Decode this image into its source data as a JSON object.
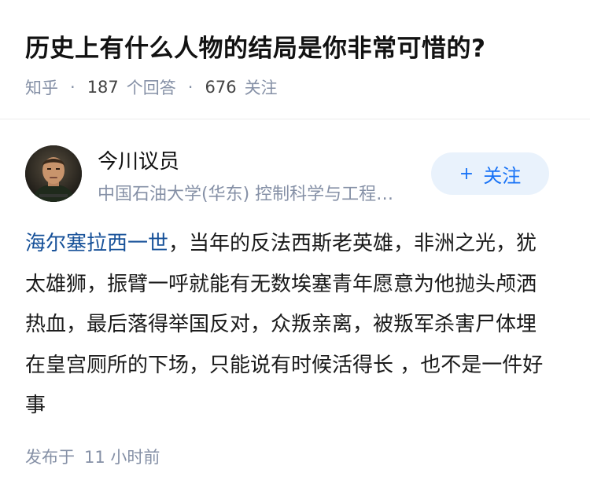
{
  "question": {
    "title": "历史上有什么人物的结局是你非常可惜的?",
    "source": "知乎",
    "separator": "·",
    "answer_count": "187",
    "answer_label": "个回答",
    "follower_count": "676",
    "follower_label": "关注"
  },
  "author": {
    "name": "今川议员",
    "bio": "中国石油大学(华东) 控制科学与工程…",
    "follow_plus": "+",
    "follow_label": "关注"
  },
  "answer": {
    "link_text": "海尔塞拉西一世",
    "body": "，当年的反法西斯老英雄，非洲之光，犹太雄狮，振臂一呼就能有无数埃塞青年愿意为他抛头颅洒热血，最后落得举国反对，众叛亲离，被叛军杀害尸体埋在皇宫厕所的下场，只能说有时候活得长 ，也不是一件好事"
  },
  "footer": {
    "published_label": "发布于",
    "published_time": "11 小时前"
  },
  "colors": {
    "meta_gray": "#8590a6",
    "link_blue": "#175199",
    "follow_blue": "#1772f6",
    "follow_bg": "#e9f2fc"
  }
}
